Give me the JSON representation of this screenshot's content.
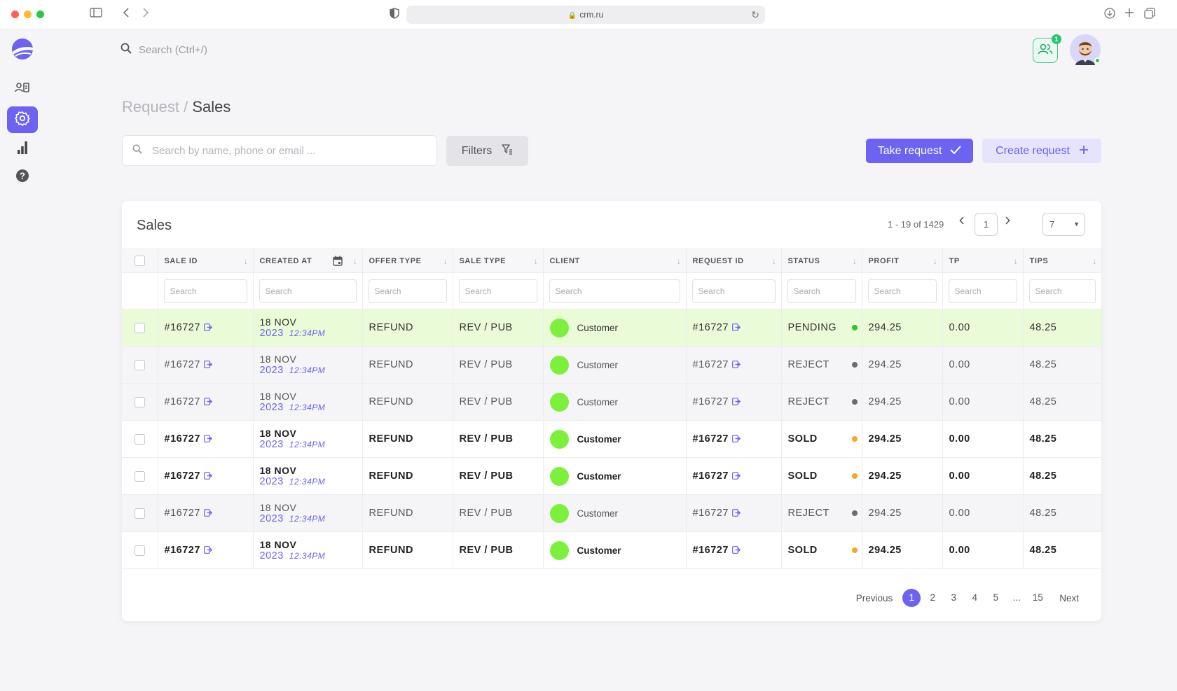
{
  "browser": {
    "url": "crm.ru"
  },
  "top": {
    "search_placeholder": "Search (Ctrl+/)",
    "users_badge": "1"
  },
  "breadcrumb": {
    "parent": "Request",
    "separator": "/",
    "current": "Sales"
  },
  "toolbar": {
    "search_placeholder": "Search by name, phone or email ...",
    "filters_label": "Filters",
    "take_label": "Take request",
    "create_label": "Create request"
  },
  "table": {
    "title": "Sales",
    "range_text": "1 - 19 of 1429",
    "page_input": "1",
    "page_size": "7",
    "search_placeholder": "Search",
    "columns": [
      "SALE ID",
      "CREATED AT",
      "OFFER TYPE",
      "SALE TYPE",
      "CLIENT",
      "REQUEST ID",
      "STATUS",
      "PROFIT",
      "TP",
      "TIPS"
    ],
    "rows": [
      {
        "sale_id": "#16727",
        "date_day": "18 NOV",
        "date_year": "2023",
        "date_time": "12:34PM",
        "offer_type": "REFUND",
        "sale_type": "REV / PUB",
        "client": "Customer",
        "request_id": "#16727",
        "status": "PENDING",
        "profit": "294.25",
        "tp": "0.00",
        "tips": "48.25"
      },
      {
        "sale_id": "#16727",
        "date_day": "18 NOV",
        "date_year": "2023",
        "date_time": "12:34PM",
        "offer_type": "REFUND",
        "sale_type": "REV / PUB",
        "client": "Customer",
        "request_id": "#16727",
        "status": "REJECT",
        "profit": "294.25",
        "tp": "0.00",
        "tips": "48.25"
      },
      {
        "sale_id": "#16727",
        "date_day": "18 NOV",
        "date_year": "2023",
        "date_time": "12:34PM",
        "offer_type": "REFUND",
        "sale_type": "REV / PUB",
        "client": "Customer",
        "request_id": "#16727",
        "status": "REJECT",
        "profit": "294.25",
        "tp": "0.00",
        "tips": "48.25"
      },
      {
        "sale_id": "#16727",
        "date_day": "18 NOV",
        "date_year": "2023",
        "date_time": "12:34PM",
        "offer_type": "REFUND",
        "sale_type": "REV / PUB",
        "client": "Customer",
        "request_id": "#16727",
        "status": "SOLD",
        "profit": "294.25",
        "tp": "0.00",
        "tips": "48.25"
      },
      {
        "sale_id": "#16727",
        "date_day": "18 NOV",
        "date_year": "2023",
        "date_time": "12:34PM",
        "offer_type": "REFUND",
        "sale_type": "REV / PUB",
        "client": "Customer",
        "request_id": "#16727",
        "status": "SOLD",
        "profit": "294.25",
        "tp": "0.00",
        "tips": "48.25"
      },
      {
        "sale_id": "#16727",
        "date_day": "18 NOV",
        "date_year": "2023",
        "date_time": "12:34PM",
        "offer_type": "REFUND",
        "sale_type": "REV / PUB",
        "client": "Customer",
        "request_id": "#16727",
        "status": "REJECT",
        "profit": "294.25",
        "tp": "0.00",
        "tips": "48.25"
      },
      {
        "sale_id": "#16727",
        "date_day": "18 NOV",
        "date_year": "2023",
        "date_time": "12:34PM",
        "offer_type": "REFUND",
        "sale_type": "REV / PUB",
        "client": "Customer",
        "request_id": "#16727",
        "status": "SOLD",
        "profit": "294.25",
        "tp": "0.00",
        "tips": "48.25"
      }
    ]
  },
  "pagination": {
    "previous": "Previous",
    "pages": [
      "1",
      "2",
      "3",
      "4",
      "5"
    ],
    "ellipsis": "...",
    "last": "15",
    "next": "Next"
  },
  "colors": {
    "accent": "#6c63f2",
    "pending_row": "#eafbd7",
    "pending_dot": "#2fc52f",
    "reject_dot": "#6b6b70",
    "sold_dot": "#f5a623",
    "client_avatar": "#7df03d"
  },
  "icons": {
    "sidebar": [
      "contacts-icon",
      "settings-icon",
      "chart-icon",
      "help-icon"
    ]
  }
}
